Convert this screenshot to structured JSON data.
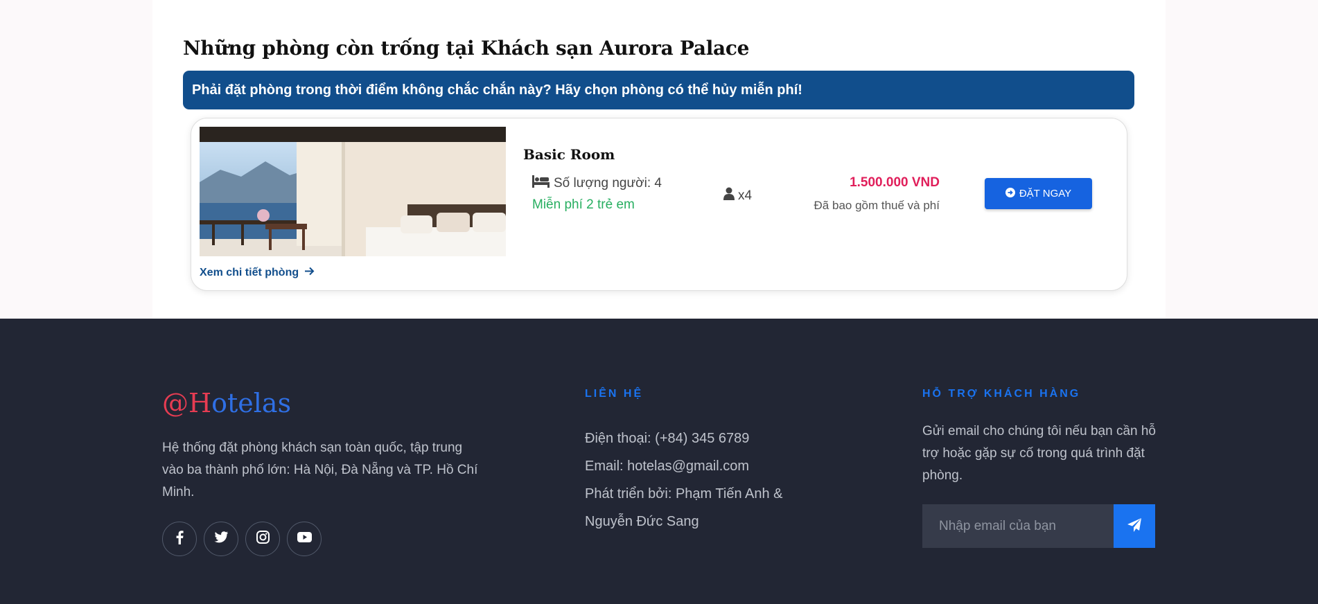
{
  "rooms_section": {
    "title": "Những phòng còn trống tại Khách sạn Aurora Palace",
    "banner": "Phải đặt phòng trong thời điểm không chắc chắn này? Hãy chọn phòng có thể hủy miễn phí!"
  },
  "room": {
    "name": "Basic Room",
    "capacity": "Số lượng người: 4",
    "free_kids": "Miễn phí 2 trẻ em",
    "person_count": "x4",
    "price": "1.500.000 VND",
    "price_note": "Đã bao gồm thuế và phí",
    "book_label": "ĐẶT NGAY",
    "detail_link": "Xem chi tiết phòng"
  },
  "footer": {
    "brand_prefix": "@H",
    "brand_suffix": "otelas",
    "about": "Hệ thống đặt phòng khách sạn toàn quốc, tập trung vào ba thành phố lớn: Hà Nội, Đà Nẵng và TP. Hồ Chí Minh.",
    "social_icons": [
      "facebook-icon",
      "twitter-icon",
      "instagram-icon",
      "youtube-icon"
    ],
    "contact_heading": "LIÊN HỆ",
    "phone": "Điện thoại: (+84) 345 6789",
    "email": "Email: hotelas@gmail.com",
    "developers": "Phát triển bởi: Phạm Tiến Anh & Nguyễn Đức Sang",
    "support_heading": "HỖ TRỢ KHÁCH HÀNG",
    "support_text": "Gửi email cho chúng tôi nếu bạn cần hỗ trợ hoặc gặp sự cố trong quá trình đặt phòng.",
    "email_placeholder": "Nhập email của bạn"
  },
  "colors": {
    "banner": "#114e8c",
    "price": "#e01e5a",
    "free": "#27ae60",
    "button": "#1663e0",
    "footer_bg": "#222634",
    "accent": "#1a73f0",
    "brand_red": "#e63c52"
  }
}
